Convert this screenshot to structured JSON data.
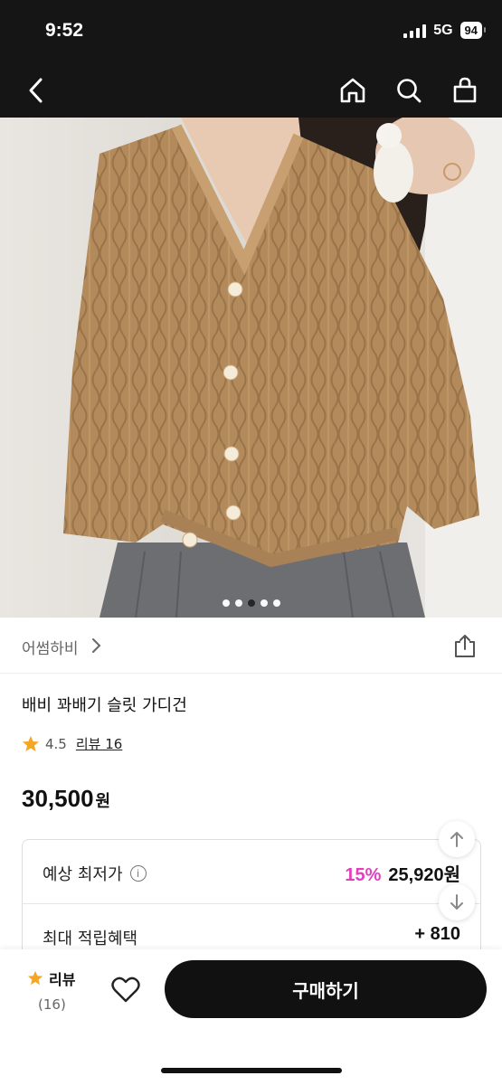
{
  "status": {
    "time": "9:52",
    "network": "5G",
    "battery": "94"
  },
  "store": {
    "name": "어썸하비"
  },
  "product": {
    "title": "배비 꽈배기 슬릿 가디건",
    "rating": "4.5",
    "review_link": "리뷰 16",
    "price": "30,500",
    "price_unit": "원"
  },
  "price_box": {
    "expected_label": "예상 최저가",
    "discount": "15%",
    "expected_price": "25,920원",
    "points_label": "최대 적립혜택",
    "points_value": "+ 810"
  },
  "gallery": {
    "total": 5,
    "active_index": 2
  },
  "bottom": {
    "review_label": "리뷰",
    "review_count": "(16)",
    "buy_label": "구매하기"
  },
  "colors": {
    "accent_pink": "#e23fbf",
    "star": "#f5a623",
    "sweater": "#b28a5c"
  }
}
